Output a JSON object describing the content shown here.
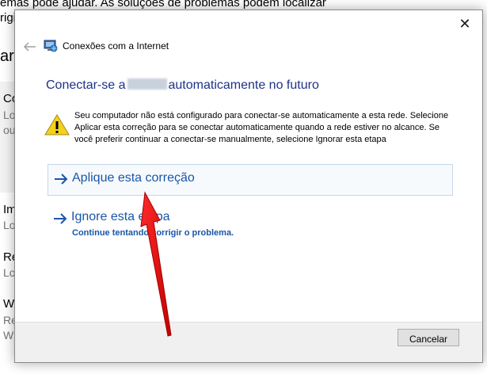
{
  "background": {
    "line1": "emas pode ajudar. As soluções de problemas podem localizar",
    "line2": "rigi",
    "heading": "ar",
    "items": [
      {
        "title": "Co",
        "sub1": "Lo",
        "sub2": "ou"
      },
      {
        "title": "Im",
        "sub1": "Lo"
      },
      {
        "title": "Re",
        "sub1": "Lo"
      },
      {
        "title": "W",
        "sub1": "Re",
        "sub2": "W"
      }
    ]
  },
  "dialog": {
    "window_title": "Conexões com a Internet",
    "heading_before": "Conectar-se a",
    "heading_after": "automaticamente no futuro",
    "warning_text": "Seu computador não está configurado para conectar-se automaticamente a esta rede. Selecione Aplicar esta correção para se conectar automaticamente quando a rede estiver no alcance. Se você preferir continuar a conectar-se manualmente, selecione Ignorar esta etapa",
    "option_apply": "Aplique esta correção",
    "option_ignore": "Ignore esta etapa",
    "option_ignore_sub": "Continue tentando corrigir o problema.",
    "cancel_label": "Cancelar",
    "close_glyph": "✕"
  },
  "colors": {
    "heading": "#1e3287",
    "link": "#1a56a8",
    "warning": "#f4d21c",
    "annotation_arrow": "#e01010"
  },
  "icons": {
    "back": "back-arrow-icon",
    "app": "network-troubleshooter-icon",
    "warning": "warning-triangle-icon",
    "option": "right-arrow-icon",
    "annotation": "red-arrow-annotation"
  }
}
